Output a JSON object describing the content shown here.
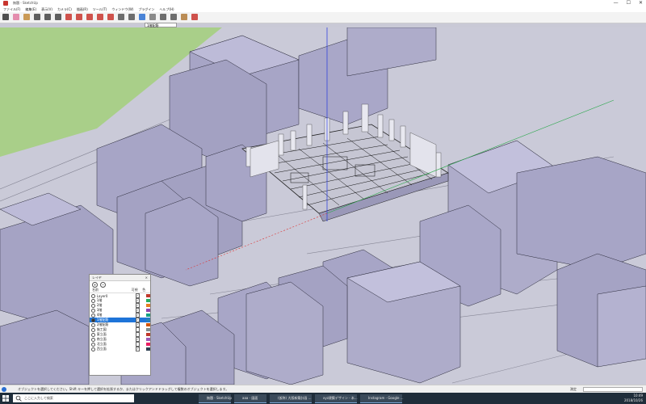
{
  "window": {
    "title": "無題 - SketchUp",
    "controls": [
      "—",
      "☐",
      "✕"
    ]
  },
  "menu": [
    "ファイル(F)",
    "編集(E)",
    "表示(V)",
    "カメラ(C)",
    "描画(R)",
    "ツール(T)",
    "ウィンドウ(W)",
    "プラグイン",
    "ヘルプ(H)"
  ],
  "toolbar": {
    "icons": [
      "select-icon",
      "eraser-icon",
      "paint-icon",
      "line-icon",
      "arc-icon",
      "rectangle-icon",
      "pushpull-icon",
      "move-icon",
      "rotate-icon",
      "scale-icon",
      "offset-icon",
      "tape-icon",
      "text-icon",
      "orbit-icon",
      "pan-icon",
      "zoom-icon",
      "zoom-extents-icon",
      "sandbox-icon",
      "warehouse-icon"
    ],
    "layer_select": "1階配筋"
  },
  "layers": {
    "title": "レイヤ",
    "col_name": "名前",
    "col_visible": "可視",
    "col_color": "色",
    "rows": [
      {
        "name": "Layer0",
        "active": false,
        "visible": true,
        "color": "#c0392b"
      },
      {
        "name": "1階",
        "active": false,
        "visible": true,
        "color": "#27ae60"
      },
      {
        "name": "2階",
        "active": false,
        "visible": true,
        "color": "#e67e22"
      },
      {
        "name": "3階",
        "active": false,
        "visible": true,
        "color": "#8e44ad"
      },
      {
        "name": "4階",
        "active": false,
        "visible": true,
        "color": "#16a085"
      },
      {
        "name": "1階配筋",
        "active": true,
        "visible": true,
        "color": "#2980b9"
      },
      {
        "name": "2階配筋",
        "active": false,
        "visible": true,
        "color": "#d35400"
      },
      {
        "name": "施工図",
        "active": false,
        "visible": false,
        "color": "#7f8c8d"
      },
      {
        "name": "東立面",
        "active": false,
        "visible": false,
        "color": "#c0392b"
      },
      {
        "name": "南立面",
        "active": false,
        "visible": true,
        "color": "#9b59b6"
      },
      {
        "name": "北立面",
        "active": false,
        "visible": false,
        "color": "#e91e63"
      },
      {
        "name": "西立面",
        "active": false,
        "visible": true,
        "color": "#2c3e50"
      }
    ]
  },
  "status": {
    "message": "オブジェクトを選択してください。Shift キーを押して選択を拡張するか、またはクリックアンドドラッグして複数のオブジェクトを選択します。",
    "measurement_label": "測定"
  },
  "taskbar": {
    "search_placeholder": "ここに入力して検索",
    "apps": [
      "無題 - SketchUp",
      "aaa - 図面",
      "(仮称) 大阪新築計画 ...",
      "xyz建築デザイン - 本...",
      "Instagram - Google ..."
    ],
    "time": "10:49",
    "date": "2018/10/26"
  },
  "colors": {
    "building": "#a9a7c8",
    "ground": "#c9c9d6",
    "grass": "#a9cf89",
    "selection": "#1e74d8"
  }
}
